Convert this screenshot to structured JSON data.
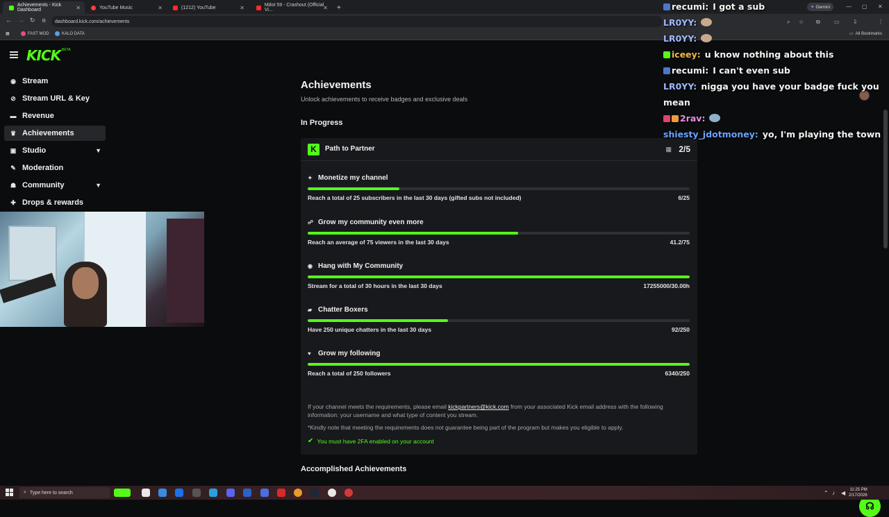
{
  "browser": {
    "tabs": [
      {
        "label": "Achievements - Kick Dashboard",
        "color": "#53fc18"
      },
      {
        "label": "YouTube Music",
        "color": "#ff3b3b"
      },
      {
        "label": "(1212) YouTube",
        "color": "#ff2a2a"
      },
      {
        "label": "Mdot 59 - Crashout (Official Vi...",
        "color": "#ff2a2a"
      }
    ],
    "url": "dashboard.kick.com/achievements",
    "bookmarks": [
      {
        "label": "FAST MOD",
        "color": "#e44d7c"
      },
      {
        "label": "KALO DATA",
        "color": "#5aa0e6"
      }
    ],
    "all_bookmarks": "All Bookmarks",
    "gemini": "Gemini"
  },
  "logo": {
    "text": "KICK",
    "beta": "BETA"
  },
  "sidebar": {
    "items": [
      {
        "label": "Stream",
        "icon": "broadcast-icon"
      },
      {
        "label": "Stream URL & Key",
        "icon": "link-icon"
      },
      {
        "label": "Revenue",
        "icon": "money-icon"
      },
      {
        "label": "Achievements",
        "icon": "trophy-icon"
      },
      {
        "label": "Studio",
        "icon": "studio-icon"
      },
      {
        "label": "Moderation",
        "icon": "wrench-icon"
      },
      {
        "label": "Community",
        "icon": "community-icon"
      },
      {
        "label": "Drops & rewards",
        "icon": "gift-icon"
      }
    ]
  },
  "main": {
    "title": "Achievements",
    "subtitle": "Unlock achievements to receive badges and exclusive deals",
    "in_progress": "In Progress",
    "card": {
      "title": "Path to Partner",
      "count": "2/5",
      "achievements": [
        {
          "name": "Monetize my channel",
          "desc": "Reach a total of 25 subscribers in the last 30 days (gifted subs not included)",
          "value": "6/25",
          "progress": 0.24
        },
        {
          "name": "Grow my community even more",
          "desc": "Reach an average of 75 viewers in the last 30 days",
          "value": "41.2/75",
          "progress": 0.55
        },
        {
          "name": "Hang with My Community",
          "desc": "Stream for a total of 30 hours in the last 30 days",
          "value": "17255000/30.00h",
          "progress": 1.0
        },
        {
          "name": "Chatter Boxers",
          "desc": "Have 250 unique chatters in the last 30 days",
          "value": "92/250",
          "progress": 0.368
        },
        {
          "name": "Grow my following",
          "desc": "Reach a total of 250 followers",
          "value": "6340/250",
          "progress": 1.0
        }
      ],
      "info_prefix": "If your channel meets the requirements, please email ",
      "info_email": "kickpartners@kick.com",
      "info_suffix": " from your associated Kick email address with the following information: your username and what type of content you stream.",
      "note": "*Kindly note that meeting the requirements does not guarantee being part of the program but makes you eligible to apply.",
      "twofa": "You must have 2FA enabled on your account"
    },
    "accomplished": "Accomplished Achievements"
  },
  "chat": [
    {
      "user": "recumi:",
      "text": "I got a sub",
      "color": "#f3f3f3"
    },
    {
      "user": "LR0YY:",
      "text": "",
      "color": "#9fb8ff"
    },
    {
      "user": "LR0YY:",
      "text": "",
      "color": "#9fb8ff"
    },
    {
      "user": "iceey:",
      "text": "u know nothing about this",
      "color": "#f0b84a"
    },
    {
      "user": "recumi:",
      "text": "I can't even sub",
      "color": "#f3f3f3"
    },
    {
      "user": "LR0YY:",
      "text": "nigga you have your badge fuck you",
      "color": "#9fb8ff"
    },
    {
      "user": "",
      "text": "mean",
      "color": "#f3f3f3"
    },
    {
      "user": "2rav:",
      "text": "",
      "color": "#e88de0"
    },
    {
      "user": "shiesty_jdotmoney:",
      "text": "yo, I'm playing the town",
      "color": "#6aa2ff"
    }
  ],
  "taskbar": {
    "search_placeholder": "Type here to search",
    "time": "11:25 PM",
    "date": "2/17/2026"
  }
}
